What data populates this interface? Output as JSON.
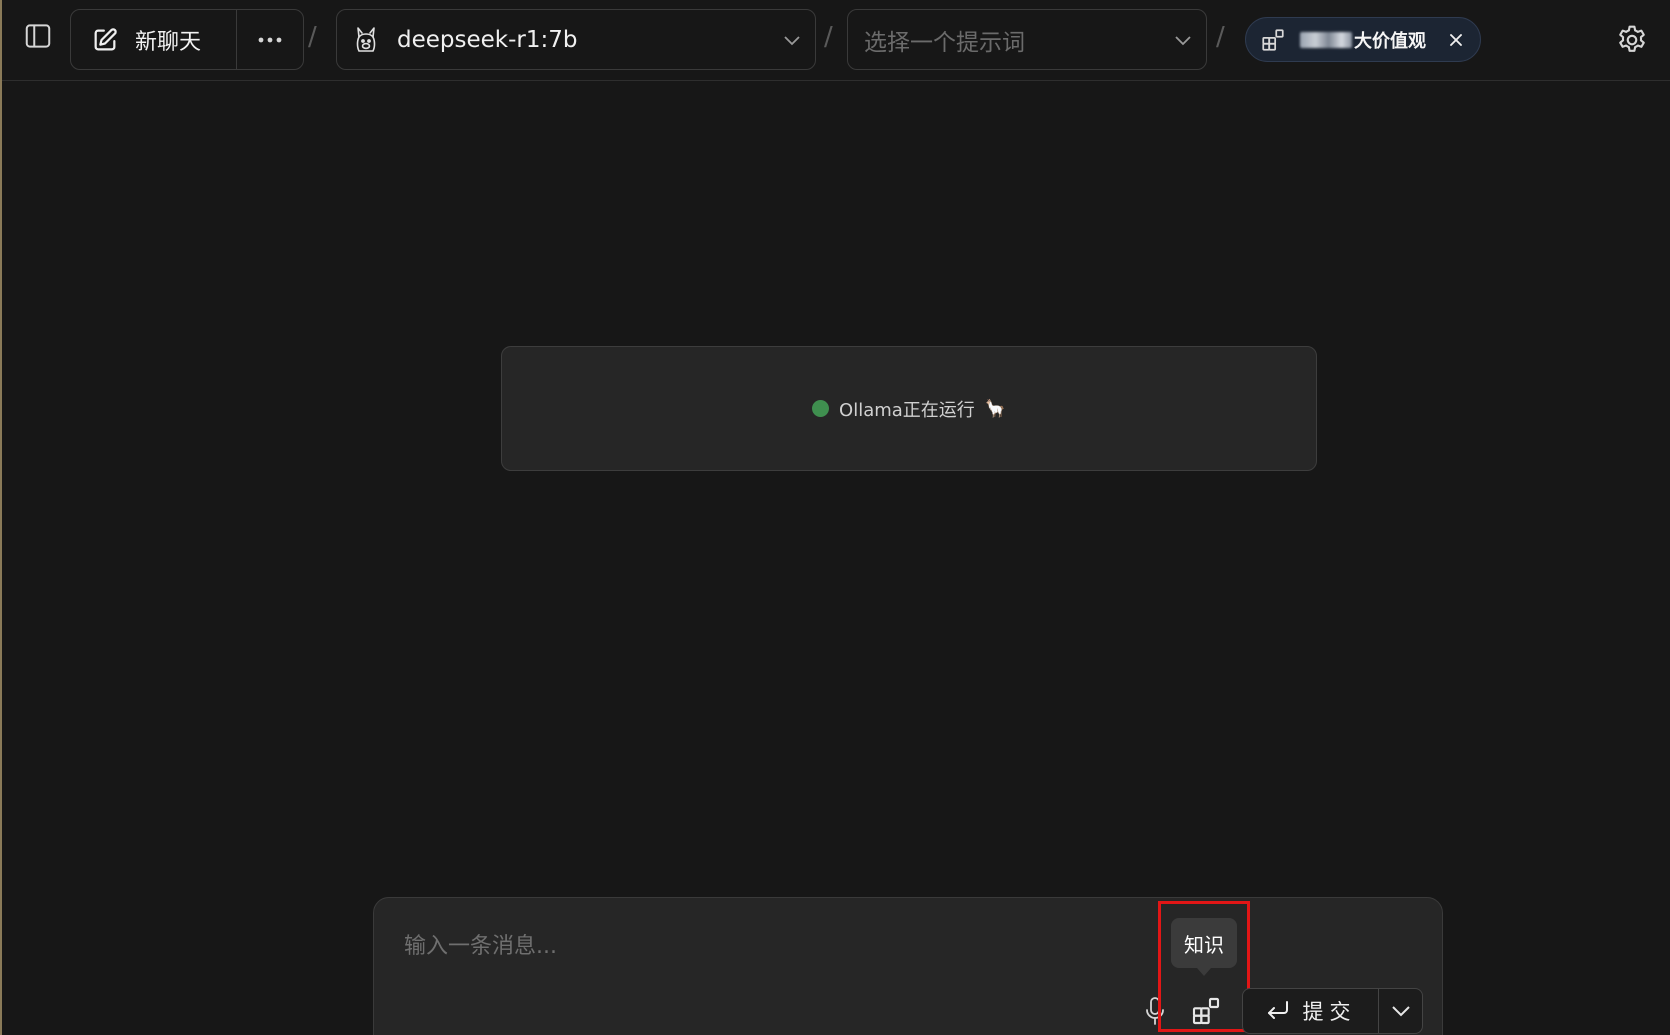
{
  "topbar": {
    "new_chat_label": "新聊天",
    "separator": "/",
    "model": {
      "selected": "deepseek-r1:7b"
    },
    "prompt": {
      "placeholder": "选择一个提示词"
    },
    "knowledge_tag": {
      "label": "大价值观"
    }
  },
  "status": {
    "text": "Ollama正在运行",
    "emoji": "🦙",
    "dot_color": "#3f8f4f"
  },
  "composer": {
    "placeholder": "输入一条消息...",
    "tooltip": "知识",
    "submit_label": "提交"
  },
  "colors": {
    "background": "#171717",
    "card": "#262626",
    "highlight": "#e21616"
  },
  "icons": {
    "sidebar_toggle": "sidebar-panel-icon",
    "new_chat": "pencil-square-icon",
    "more": "ellipsis-icon",
    "model": "llama-icon",
    "dropdown": "chevron-down-icon",
    "knowledge": "blocks-icon",
    "close": "close-icon",
    "settings": "gear-icon",
    "mic": "microphone-icon",
    "enter": "enter-arrow-icon"
  }
}
